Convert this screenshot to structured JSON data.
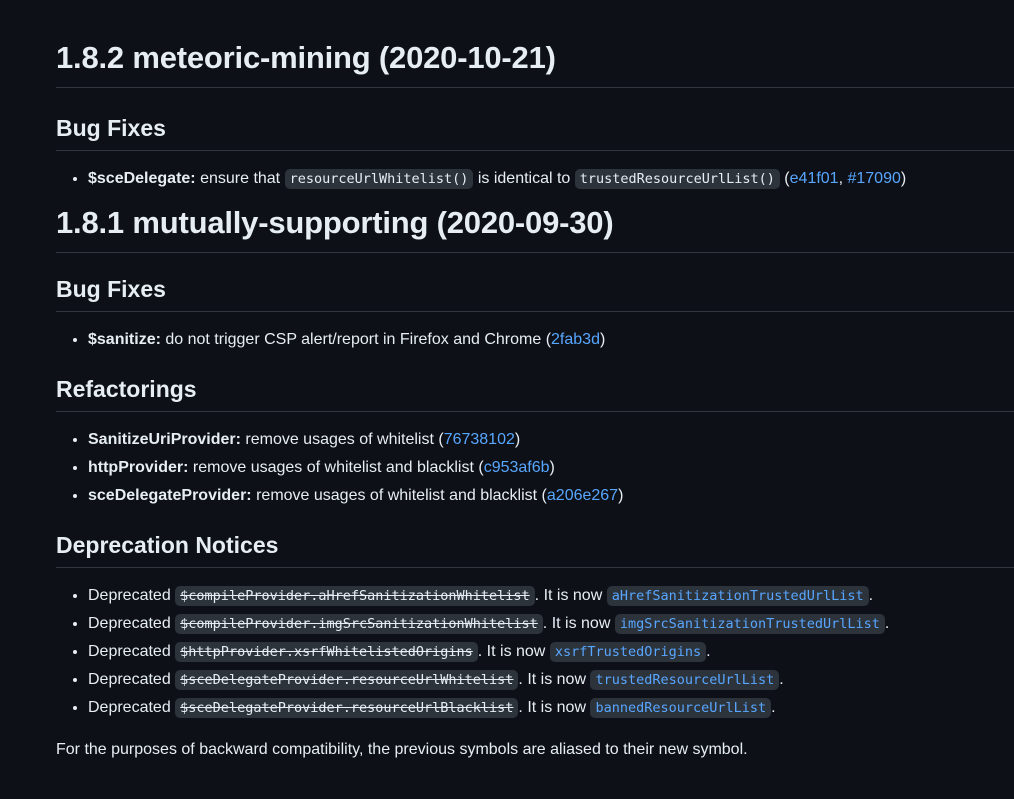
{
  "sections": [
    {
      "title": "1.8.2 meteoric-mining (2020-10-21)",
      "bug_fixes_heading": "Bug Fixes",
      "bug_fixes": [
        {
          "scope": "$sceDelegate:",
          "text_a": " ensure that ",
          "code_a": "resourceUrlWhitelist()",
          "text_b": " is identical to ",
          "code_b": "trustedResourceUrlList()",
          "text_c": " (",
          "link_a": "e41f01",
          "sep": ", ",
          "link_b": "#17090",
          "close": ")"
        }
      ]
    },
    {
      "title": "1.8.1 mutually-supporting (2020-09-30)",
      "bug_fixes_heading": "Bug Fixes",
      "bug_fixes": [
        {
          "scope": "$sanitize:",
          "text": " do not trigger CSP alert/report in Firefox and Chrome (",
          "link": "2fab3d",
          "close": ")"
        }
      ],
      "refactorings_heading": "Refactorings",
      "refactorings": [
        {
          "scope": "SanitizeUriProvider:",
          "text": " remove usages of whitelist (",
          "link": "76738102",
          "close": ")"
        },
        {
          "scope": "httpProvider:",
          "text": " remove usages of whitelist and blacklist (",
          "link": "c953af6b",
          "close": ")"
        },
        {
          "scope": "sceDelegateProvider:",
          "text": " remove usages of whitelist and blacklist (",
          "link": "a206e267",
          "close": ")"
        }
      ],
      "deprecations_heading": "Deprecation Notices",
      "deprecations": [
        {
          "prefix": "Deprecated ",
          "old": "$compileProvider.aHrefSanitizationWhitelist",
          "mid": ". It is now ",
          "new": "aHrefSanitizationTrustedUrlList",
          "end": "."
        },
        {
          "prefix": "Deprecated ",
          "old": "$compileProvider.imgSrcSanitizationWhitelist",
          "mid": ". It is now ",
          "new": "imgSrcSanitizationTrustedUrlList",
          "end": "."
        },
        {
          "prefix": "Deprecated ",
          "old": "$httpProvider.xsrfWhitelistedOrigins",
          "mid": ". It is now ",
          "new": "xsrfTrustedOrigins",
          "end": "."
        },
        {
          "prefix": "Deprecated ",
          "old": "$sceDelegateProvider.resourceUrlWhitelist",
          "mid": ". It is now ",
          "new": "trustedResourceUrlList",
          "end": "."
        },
        {
          "prefix": "Deprecated ",
          "old": "$sceDelegateProvider.resourceUrlBlacklist",
          "mid": ". It is now ",
          "new": "bannedResourceUrlList",
          "end": "."
        }
      ],
      "footer": "For the purposes of backward compatibility, the previous symbols are aliased to their new symbol."
    }
  ],
  "colors": {
    "background": "#0d1117",
    "text": "#e6edf3",
    "link": "#58a6ff",
    "code_bg": "#2d333b",
    "rule": "#30363d"
  }
}
